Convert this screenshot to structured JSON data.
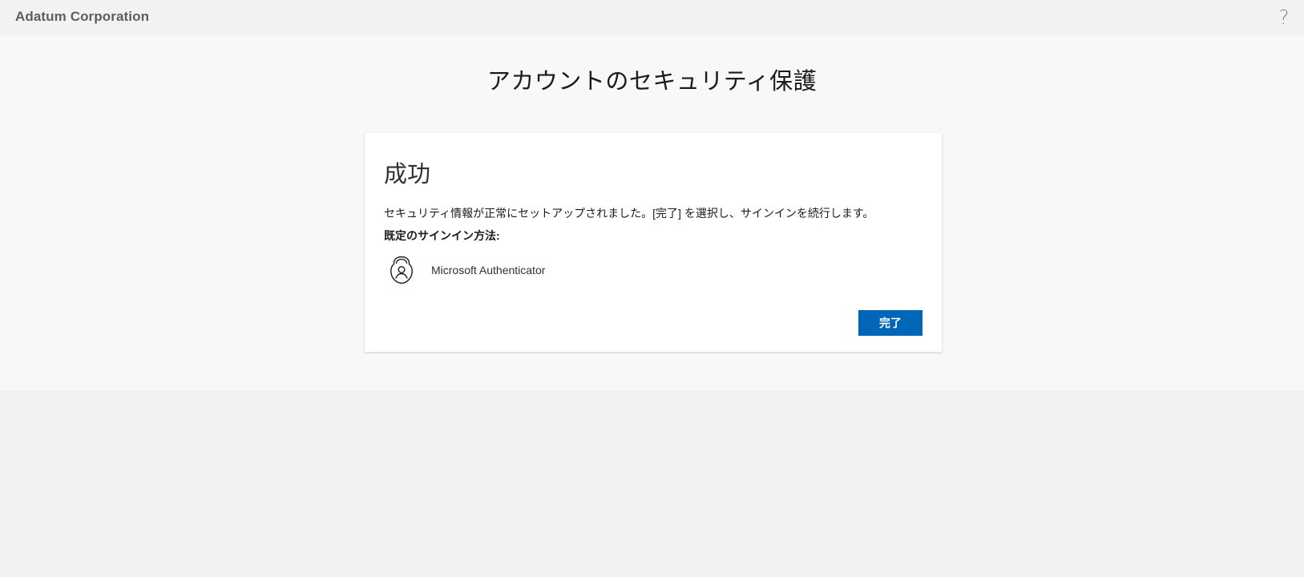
{
  "header": {
    "org_name": "Adatum Corporation",
    "help_label": "?"
  },
  "main": {
    "page_title": "アカウントのセキュリティ保護"
  },
  "card": {
    "title": "成功",
    "message": "セキュリティ情報が正常にセットアップされました。[完了] を選択し、サインインを続行します。",
    "default_method_label": "既定のサインイン方法:",
    "method": {
      "icon": "authenticator-icon",
      "name": "Microsoft Authenticator"
    },
    "done_label": "完了"
  },
  "colors": {
    "accent": "#0067b8",
    "page_background": "#f2f2f2",
    "content_background": "#f8f8f8",
    "card_background": "#ffffff"
  }
}
